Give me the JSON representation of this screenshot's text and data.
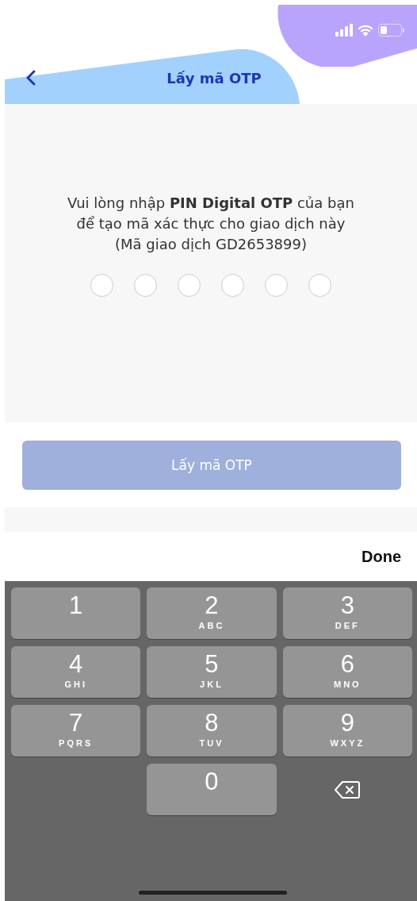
{
  "header": {
    "title": "Lấy mã OTP"
  },
  "instruction_lines": [
    "Vui lòng nhập **PIN Digital OTP** của bạn",
    "để tạo mã xác thực cho giao dịch này",
    "(Mã giao dịch GD2653899)"
  ],
  "pin_dots": [
    {
      "filled": false
    },
    {
      "filled": false
    },
    {
      "filled": false
    },
    {
      "filled": false
    },
    {
      "filled": false
    },
    {
      "filled": false
    }
  ],
  "submit_button": {
    "label": "Lấy mã OTP",
    "disabled": true
  },
  "keyboard": {
    "done_label": "Done",
    "keys": [
      {
        "kind": "digit",
        "digit": "1"
      },
      {
        "kind": "digit",
        "digit": "2",
        "letters": "ABC"
      },
      {
        "kind": "digit",
        "digit": "3",
        "letters": "DEF"
      },
      {
        "kind": "digit",
        "digit": "4",
        "letters": "GHI"
      },
      {
        "kind": "digit",
        "digit": "5",
        "letters": "JKL"
      },
      {
        "kind": "digit",
        "digit": "6",
        "letters": "MNO"
      },
      {
        "kind": "digit",
        "digit": "7",
        "letters": "PQRS"
      },
      {
        "kind": "digit",
        "digit": "8",
        "letters": "TUV"
      },
      {
        "kind": "digit",
        "digit": "9",
        "letters": "WXYZ"
      },
      {
        "kind": "blank"
      },
      {
        "kind": "digit",
        "digit": "0"
      },
      {
        "kind": "delete"
      }
    ]
  }
}
